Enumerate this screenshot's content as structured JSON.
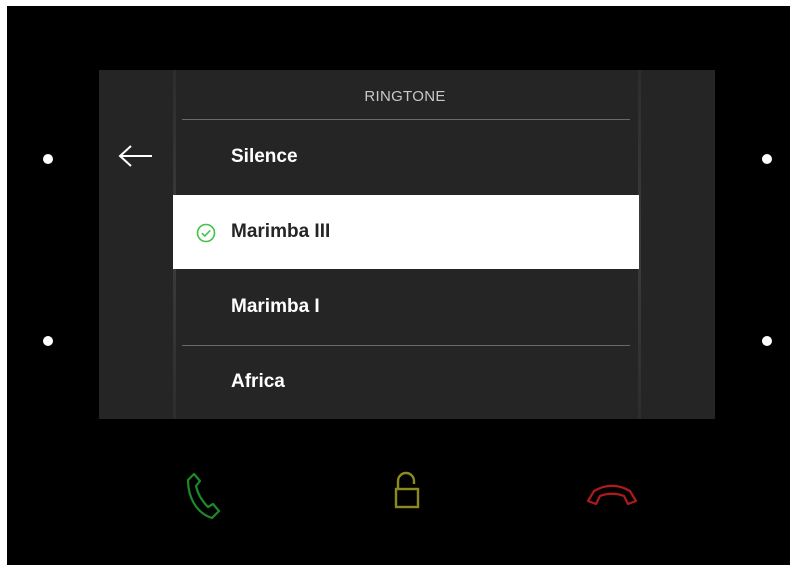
{
  "header": {
    "title": "RINGTONE"
  },
  "ringtones": [
    {
      "label": "Silence",
      "selected": false
    },
    {
      "label": "Marimba III",
      "selected": true
    },
    {
      "label": "Marimba I",
      "selected": false
    },
    {
      "label": "Africa",
      "selected": false
    }
  ],
  "icons": {
    "back": "arrow-left-icon",
    "selected": "check-circle-icon",
    "answer": "phone-answer-icon",
    "unlock": "unlock-icon",
    "hangup": "phone-hangup-icon"
  },
  "colors": {
    "check": "#43c24a",
    "answer": "#1c8a2a",
    "unlock": "#8c8a1c",
    "hangup": "#b01a1a"
  }
}
